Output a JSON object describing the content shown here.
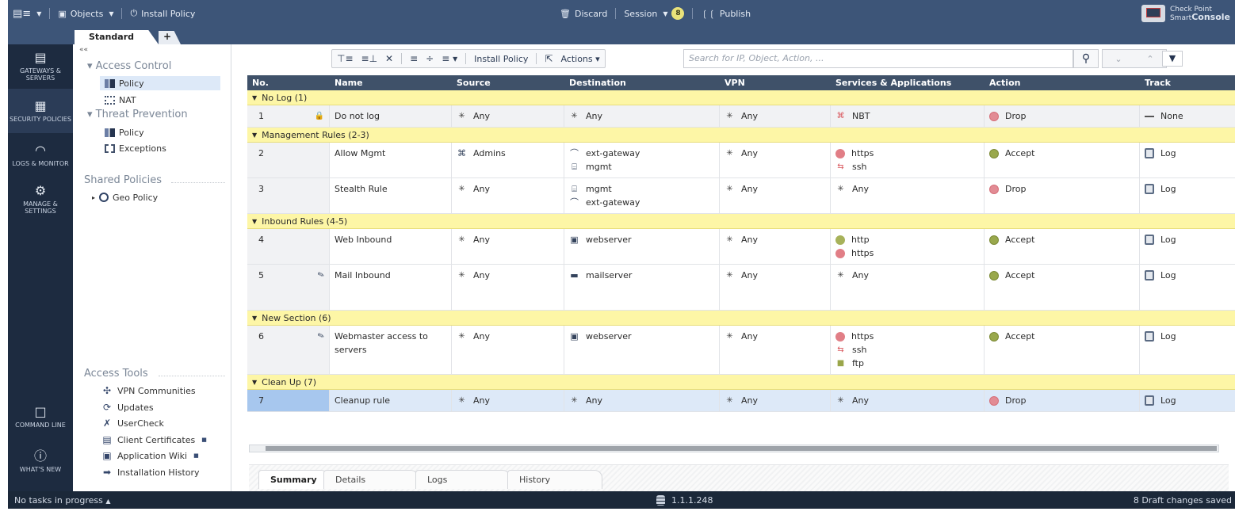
{
  "topbar": {
    "menu_label": "",
    "objects_label": "Objects",
    "install_policy_label": "Install Policy",
    "discard_label": "Discard",
    "session_label": "Session",
    "session_badge": "8",
    "publish_label": "Publish",
    "brand_line1": "Check Point",
    "brand_line2_light": "Smart",
    "brand_line2_bold": "Console"
  },
  "tabs": {
    "active_label": "Standard",
    "add_label": "+"
  },
  "leftnav": {
    "items": [
      {
        "label": "GATEWAYS & SERVERS",
        "icon": "server-icon"
      },
      {
        "label": "SECURITY POLICIES",
        "icon": "firewall-icon"
      },
      {
        "label": "LOGS & MONITOR",
        "icon": "gauge-icon"
      },
      {
        "label": "MANAGE & SETTINGS",
        "icon": "gear-icon"
      }
    ],
    "bottom": [
      {
        "label": "COMMAND LINE",
        "icon": "terminal-icon"
      },
      {
        "label": "WHAT'S NEW",
        "icon": "help-icon"
      }
    ]
  },
  "tree": {
    "collapse": "««",
    "access_control": "Access Control",
    "ac_policy": "Policy",
    "ac_nat": "NAT",
    "threat_prevention": "Threat Prevention",
    "tp_policy": "Policy",
    "tp_exceptions": "Exceptions",
    "shared_policies": "Shared Policies",
    "geo_policy": "Geo Policy",
    "access_tools": "Access Tools",
    "tools": [
      {
        "label": "VPN Communities",
        "icon": "vpn-icon",
        "external": false
      },
      {
        "label": "Updates",
        "icon": "refresh-icon",
        "external": false
      },
      {
        "label": "UserCheck",
        "icon": "usercheck-icon",
        "external": false
      },
      {
        "label": "Client Certificates",
        "icon": "certificate-icon",
        "external": true
      },
      {
        "label": "Application Wiki",
        "icon": "wiki-icon",
        "external": true
      },
      {
        "label": "Installation History",
        "icon": "download-icon",
        "external": false
      }
    ]
  },
  "toolbar": {
    "install_policy_label": "Install Policy",
    "actions_label": "Actions",
    "search_placeholder": "Search for IP, Object, Action, ..."
  },
  "table": {
    "headers": [
      "No.",
      "Name",
      "Source",
      "Destination",
      "VPN",
      "Services & Applications",
      "Action",
      "Track"
    ],
    "sections": [
      {
        "title": "No Log (1)",
        "rules": [
          {
            "no": "1",
            "flag": "lock",
            "name": "Do not log",
            "source": [
              "Any"
            ],
            "destination": [
              "Any"
            ],
            "vpn": "Any",
            "services": [
              {
                "label": "NBT",
                "type": "nbt"
              }
            ],
            "action": "Drop",
            "track": "None"
          }
        ]
      },
      {
        "title": "Management Rules (2-3)",
        "rules": [
          {
            "no": "2",
            "flag": "",
            "name": "Allow Mgmt",
            "source": [
              "Admins"
            ],
            "destination": [
              "ext-gateway",
              "mgmt"
            ],
            "vpn": "Any",
            "services": [
              {
                "label": "https",
                "type": "https"
              },
              {
                "label": "ssh",
                "type": "ssh"
              }
            ],
            "action": "Accept",
            "track": "Log"
          },
          {
            "no": "3",
            "flag": "",
            "name": "Stealth Rule",
            "source": [
              "Any"
            ],
            "destination": [
              "mgmt",
              "ext-gateway"
            ],
            "vpn": "Any",
            "services": [
              {
                "label": "Any",
                "type": "any"
              }
            ],
            "action": "Drop",
            "track": "Log"
          }
        ]
      },
      {
        "title": "Inbound Rules (4-5)",
        "rules": [
          {
            "no": "4",
            "flag": "",
            "name": "Web Inbound",
            "source": [
              "Any"
            ],
            "destination": [
              "webserver"
            ],
            "vpn": "Any",
            "services": [
              {
                "label": "http",
                "type": "http"
              },
              {
                "label": "https",
                "type": "https"
              }
            ],
            "action": "Accept",
            "track": "Log"
          },
          {
            "no": "5",
            "flag": "edit",
            "name": "Mail Inbound",
            "source": [
              "Any"
            ],
            "destination": [
              "mailserver"
            ],
            "vpn": "Any",
            "services": [
              {
                "label": "Any",
                "type": "any"
              }
            ],
            "action": "Accept",
            "track": "Log"
          }
        ]
      },
      {
        "title": "New Section (6)",
        "rules": [
          {
            "no": "6",
            "flag": "edit",
            "name": "Webmaster access to servers",
            "source": [
              "Any"
            ],
            "destination": [
              "webserver"
            ],
            "vpn": "Any",
            "services": [
              {
                "label": "https",
                "type": "https"
              },
              {
                "label": "ssh",
                "type": "ssh"
              },
              {
                "label": "ftp",
                "type": "ftp"
              }
            ],
            "action": "Accept",
            "track": "Log"
          }
        ]
      },
      {
        "title": "Clean Up (7)",
        "rules": [
          {
            "no": "7",
            "flag": "",
            "name": "Cleanup rule",
            "source": [
              "Any"
            ],
            "destination": [
              "Any"
            ],
            "vpn": "Any",
            "services": [
              {
                "label": "Any",
                "type": "any"
              }
            ],
            "action": "Drop",
            "track": "Log",
            "selected": true
          }
        ]
      }
    ]
  },
  "bottom_tabs": [
    "Summary",
    "Details",
    "Logs",
    "History"
  ],
  "statusbar": {
    "tasks": "No tasks in progress",
    "server": "1.1.1.248",
    "drafts": "8 Draft changes saved"
  },
  "colors": {
    "topbar": "#3d5578",
    "nav": "#1d2b40",
    "section": "#fdf6a6",
    "header": "#3f5169",
    "selected_row": "#dde9f8"
  }
}
